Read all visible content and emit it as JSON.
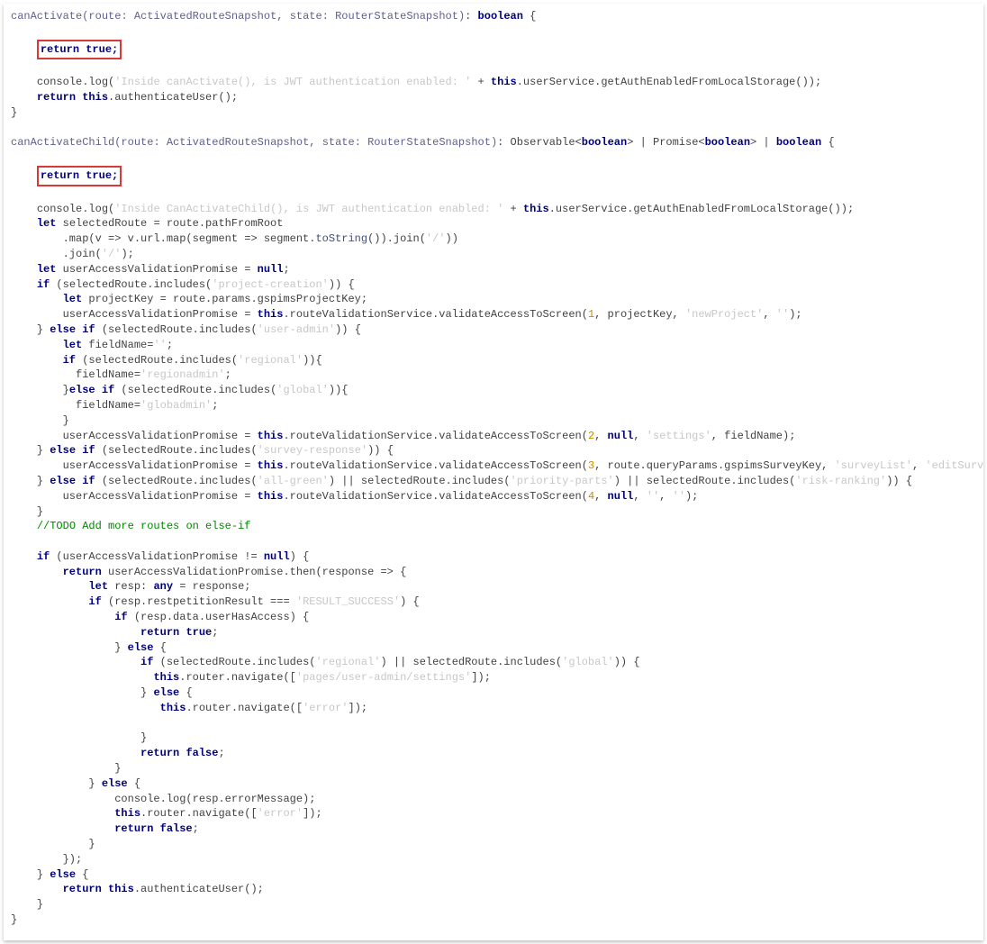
{
  "doc": {
    "language": "typescript"
  },
  "fn1": {
    "name": "canActivate",
    "paramRoute": "route",
    "typeRoute": "ActivatedRouteSnapshot",
    "paramState": "state",
    "typeState": "RouterStateSnapshot",
    "returnType": "boolean",
    "returnTrue": "return true;",
    "log1a": "console.log(",
    "log1b": "'Inside canActivate(), is JWT authentication enabled: '",
    "log1c": " + ",
    "log1d": "this",
    "log1e": ".userService.getAuthEnabledFromLocalStorage());",
    "ret": "return this",
    "retTail": ".authenticateUser();"
  },
  "fn2": {
    "name": "canActivateChild",
    "paramRoute": "route",
    "typeRoute": "ActivatedRouteSnapshot",
    "paramState": "state",
    "typeState": "RouterStateSnapshot",
    "retObs": "Observable<",
    "retBool": "boolean",
    "retClose": ">",
    "returnTrue": "return true;",
    "log1b": "'Inside CanActivateChild(), is JWT authentication enabled: '",
    "letSel": "let",
    "selVar": " selectedRoute = route.pathFromRoot",
    "mapLine": "        .map(v => v.url.map(segment => segment.",
    "toStr": "toString",
    "mapTail": "()).join(",
    "slash": "'/'",
    "mapEnd": "))",
    "joinLine": "        .join(",
    "joinEnd": ");",
    "letUav": "let",
    "uavDecl": " userAccessValidationPromise = ",
    "nullKw": "null",
    "if1": "if",
    "if1cond": " (selectedRoute.includes(",
    "pc": "'project-creation'",
    "letPk": "let",
    "pkDecl": " projectKey = route.params.gspimsProjectKey;",
    "uav1a": "userAccessValidationPromise = ",
    "this": "this",
    "vas": ".routeValidationService.validateAccessToScreen(",
    "n1": "1",
    "vas1tail": ", projectKey, ",
    "newProj": "'newProject'",
    "empty": "''",
    "elseIf": "else if",
    "ifUaCond": " (selectedRoute.includes(",
    "ua": "'user-admin'",
    "letFn": "let",
    "fnDecl": " fieldName=",
    "regional": "'regional'",
    "fnReg": "fieldName=",
    "regAdmin": "'regionadmin'",
    "else": "else",
    "global": "'global'",
    "globAdmin": "'globadmin'",
    "n2": "2",
    "vas2tail": ", ",
    "settings": "'settings'",
    "vas2end": ", fieldName);",
    "sr": "'survey-response'",
    "n3": "3",
    "vas3mid": ", route.queryParams.gspimsSurveyKey, ",
    "survList": "'surveyList'",
    "editSurv": "'editSurvey'",
    "ag": "'all-green'",
    "or": " || selectedRoute.includes(",
    "pp": "'priority-parts'",
    "rr": "'risk-ranking'",
    "n4": "4",
    "todo": "//TODO Add more routes on else-if",
    "ifUavNN": " (userAccessValidationPromise != ",
    "retUav": "return",
    "thenHead": " userAccessValidationPromise.then(response => {",
    "letResp": "let",
    "respDecl": " resp: ",
    "any": "any",
    "respEq": " = response;",
    "ifResp": " (resp.restpetitionResult === ",
    "resSuc": "'RESULT_SUCCESS'",
    "ifHas": " (resp.data.userHasAccess) {",
    "retTrue": "return true",
    "ifSr": " (selectedRoute.includes(",
    "routerNav": ".router.navigate([",
    "pagesUA": "'pages/user-admin/settings'",
    "error": "'error'",
    "retFalse": "return false",
    "clog": "console.log(resp.errorMessage);",
    "retAuth": "return this",
    "retAuthTail": ".authenticateUser();"
  }
}
